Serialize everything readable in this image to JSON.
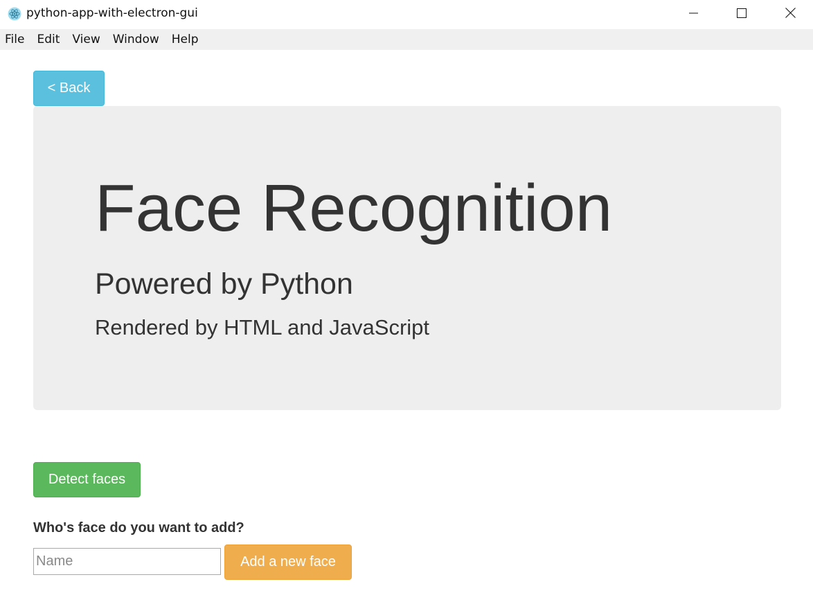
{
  "window": {
    "title": "python-app-with-electron-gui",
    "icon": "electron-atom-icon",
    "controls": [
      "minimize-icon",
      "maximize-icon",
      "close-icon"
    ]
  },
  "menu": {
    "items": [
      "File",
      "Edit",
      "View",
      "Window",
      "Help"
    ]
  },
  "nav": {
    "back_label": "< Back"
  },
  "jumbotron": {
    "title": "Face Recognition",
    "subtitle": "Powered by Python",
    "tagline": "Rendered by HTML and JavaScript"
  },
  "actions": {
    "detect_label": "Detect faces"
  },
  "add_face": {
    "question": "Who's face do you want to add?",
    "name_placeholder": "Name",
    "name_value": "",
    "add_label": "Add a new face"
  },
  "colors": {
    "info": "#5bc0de",
    "success": "#5cb85c",
    "warning": "#f0ad4e",
    "jumbotron_bg": "#eeeeee",
    "menubar_bg": "#f0f0f0"
  }
}
